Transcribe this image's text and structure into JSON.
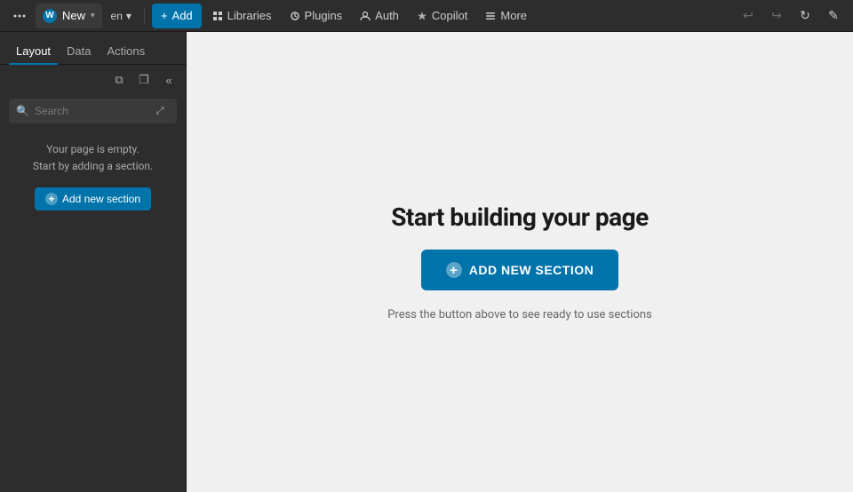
{
  "topnav": {
    "dots_label": "⋯",
    "wp_icon": "W",
    "new_label": "New",
    "chevron": "▾",
    "lang_label": "en",
    "lang_chevron": "▾",
    "add_label": "Add",
    "add_icon": "+",
    "libraries_label": "Libraries",
    "plugins_label": "Plugins",
    "auth_label": "Auth",
    "copilot_label": "Copilot",
    "more_label": "More",
    "undo_icon": "↩",
    "redo_icon": "↪",
    "refresh_icon": "↻",
    "pen_icon": "✎"
  },
  "sidebar": {
    "tab_layout": "Layout",
    "tab_data": "Data",
    "tab_actions": "Actions",
    "action_duplicate": "⧉",
    "action_copy": "❐",
    "action_collapse": "«",
    "search_placeholder": "Search",
    "expand_icon": "⤢",
    "empty_line1": "Your page is empty.",
    "empty_line2": "Start by adding a section.",
    "add_section_label": "Add new section",
    "add_section_icon": "+"
  },
  "canvas": {
    "heading": "Start building your page",
    "add_button_label": "ADD NEW SECTION",
    "add_button_icon": "+",
    "sub_text": "Press the button above to see ready to use sections"
  }
}
